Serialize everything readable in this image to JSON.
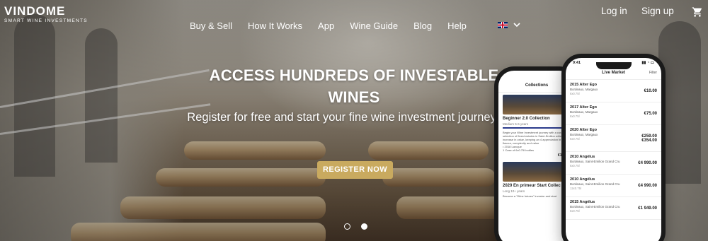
{
  "brand": {
    "name": "VINDOME",
    "tagline": "SMART WINE INVESTMENTS"
  },
  "nav": {
    "items": [
      "Buy & Sell",
      "How It Works",
      "App",
      "Wine Guide",
      "Blog",
      "Help"
    ],
    "language_icon": "uk-flag-icon",
    "chevron_icon": "chevron-down-icon"
  },
  "auth": {
    "login": "Log in",
    "signup": "Sign up",
    "cart_icon": "cart-icon"
  },
  "hero": {
    "headline": "ACCESS HUNDREDS OF INVESTABLE WINES",
    "subheadline": "Register for free and start your fine wine investment journey now",
    "cta": "REGISTER NOW",
    "slides": 2,
    "active_slide": 2
  },
  "colors": {
    "cta": "#c9aa5f",
    "text": "#ffffff"
  },
  "phone_back": {
    "title": "Collections",
    "collections": [
      {
        "name": "Beginner 2.0 Collection",
        "meta": "Medium 5-6 years",
        "text": "Begin your Wine Investment journey with a curated selection of finest estates in Saint-Emilion which will increase in value, keeping an 4 appreciation in flavour, complexity and value",
        "items": [
          "• 2018 Larcque",
          "1 Case of 6x0.75l bottles"
        ],
        "price": "€170.00"
      },
      {
        "name": "2020 En primeur Start Collec",
        "meta": "Long 10+ years",
        "text": "Become a \"Wine futures\" investor and start",
        "items": [],
        "price": ""
      }
    ]
  },
  "phone_front": {
    "time": "9:41",
    "title": "Live Market",
    "filter": "Filter",
    "wines": [
      {
        "name": "2015 Alter Ego",
        "region": "Bordeaux, Margaux",
        "size": "6x0.75l",
        "price": "€10.00",
        "price2": ""
      },
      {
        "name": "2017 Alter Ego",
        "region": "Bordeaux, Margaux",
        "size": "6x0.75l",
        "price": "€75.00",
        "price2": ""
      },
      {
        "name": "2020 Alter Ego",
        "region": "Bordeaux, Margaux",
        "size": "6x0.75l",
        "price": "€259.00",
        "price2": "€354.00"
      },
      {
        "name": "2010 Angélus",
        "region": "Bordeaux, Saint-Emilion Grand Cru",
        "size": "6x0.75l",
        "price": "€4 990.00",
        "price2": ""
      },
      {
        "name": "2010 Angélus",
        "region": "Bordeaux, Saint-Emilion Grand Cru",
        "size": "12x0.75l",
        "price": "€4 990.00",
        "price2": ""
      },
      {
        "name": "2015 Angélus",
        "region": "Bordeaux, Saint-Emilion Grand Cru",
        "size": "6x0.75l",
        "price": "€1 949.00",
        "price2": ""
      }
    ]
  }
}
